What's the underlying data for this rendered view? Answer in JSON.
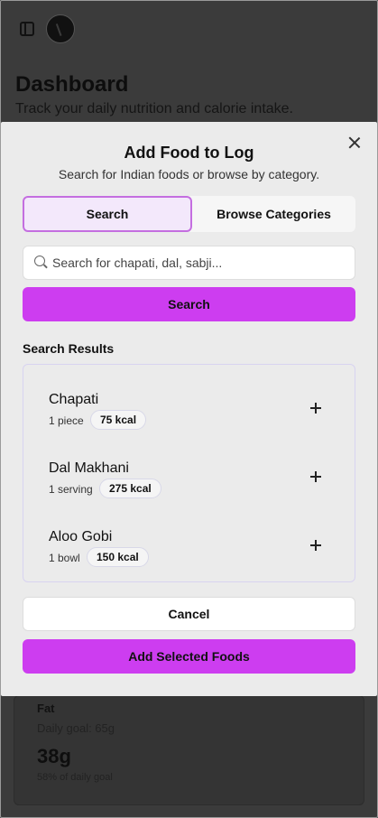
{
  "background": {
    "title": "Dashboard",
    "subtitle": "Track your daily nutrition and calorie intake.",
    "card": {
      "label": "Fat",
      "goal": "Daily goal: 65g",
      "value": "38g",
      "percent": "58% of daily goal"
    }
  },
  "modal": {
    "title": "Add Food to Log",
    "subtitle": "Search for Indian foods or browse by category.",
    "tabs": [
      {
        "label": "Search",
        "active": true
      },
      {
        "label": "Browse Categories",
        "active": false
      }
    ],
    "search": {
      "placeholder": "Search for chapati, dal, sabji...",
      "value": "",
      "button_label": "Search"
    },
    "results_label": "Search Results",
    "results": [
      {
        "name": "Chapati",
        "serving": "1 piece",
        "kcal": "75 kcal"
      },
      {
        "name": "Dal Makhani",
        "serving": "1 serving",
        "kcal": "275 kcal"
      },
      {
        "name": "Aloo Gobi",
        "serving": "1 bowl",
        "kcal": "150 kcal"
      }
    ],
    "cancel_label": "Cancel",
    "add_label": "Add Selected Foods"
  },
  "colors": {
    "accent": "#cd3df0",
    "tab_active_bg": "#f3e8fb",
    "tab_active_border": "#c46ee0",
    "overlay": "#3b3b3b"
  },
  "icons": [
    "sidebar-toggle-icon",
    "close-icon",
    "search-icon",
    "plus-icon"
  ]
}
